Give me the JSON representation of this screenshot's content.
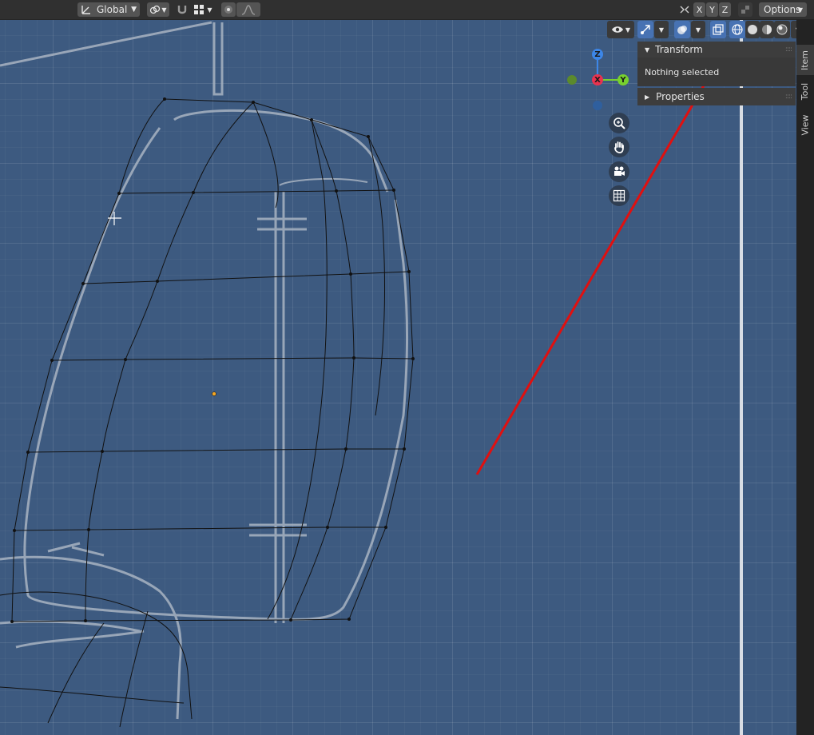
{
  "header": {
    "orientation_label": "Global",
    "axes": [
      "X",
      "Y",
      "Z"
    ],
    "options_label": "Options"
  },
  "npanel": {
    "transform_title": "Transform",
    "nothing_selected": "Nothing selected",
    "properties_title": "Properties",
    "tabs": [
      "Item",
      "Tool",
      "View"
    ]
  },
  "gizmo": {
    "z_label": "Z",
    "x_label": "X",
    "y_label": "Y",
    "colors": {
      "x": "#e8334f",
      "y": "#78d12e",
      "z": "#3c86e8"
    }
  },
  "colors": {
    "viewport_bg": "#3d5a80",
    "panel_bg": "#3d3d3d",
    "header_bg": "#303030",
    "active_button": "#4772b3",
    "annotation_arrow": "#e01010"
  },
  "icons": {
    "transform_pivot": "transform-pivot-icon",
    "link": "link-icon",
    "snap": "snap-magnet-icon",
    "snap_grid": "snap-grid-icon",
    "proportional_edit": "proportional-edit-icon",
    "falloff": "falloff-curve-icon",
    "mirror": "mirror-icon",
    "visibility": "eye-icon",
    "gizmo_toggle": "gizmo-icon",
    "overlay_toggle": "overlay-icon",
    "xray": "xray-icon",
    "shading_wireframe": "wireframe-shading-icon",
    "shading_solid": "solid-shading-icon",
    "shading_material": "material-shading-icon",
    "shading_rendered": "rendered-shading-icon",
    "zoom": "zoom-icon",
    "pan": "hand-icon",
    "camera": "camera-icon",
    "perspective": "grid-perspective-icon"
  }
}
